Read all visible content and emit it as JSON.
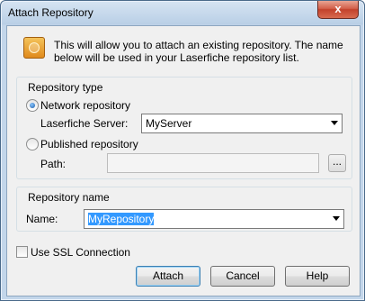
{
  "window": {
    "title": "Attach Repository",
    "close_label": "x"
  },
  "info": {
    "text": "This will allow you to attach an existing repository.  The name below will be used in your Laserfiche repository list."
  },
  "repository_type": {
    "group_title": "Repository type",
    "network_label": "Network repository",
    "server_label": "Laserfiche Server:",
    "server_value": "MyServer",
    "published_label": "Published repository",
    "path_label": "Path:",
    "path_value": "",
    "browse_label": "...",
    "selected": "network"
  },
  "repository_name": {
    "group_title": "Repository name",
    "name_label": "Name:",
    "name_value": "MyRepository"
  },
  "ssl": {
    "label": "Use SSL Connection",
    "checked": false
  },
  "buttons": {
    "attach": "Attach",
    "cancel": "Cancel",
    "help": "Help"
  }
}
